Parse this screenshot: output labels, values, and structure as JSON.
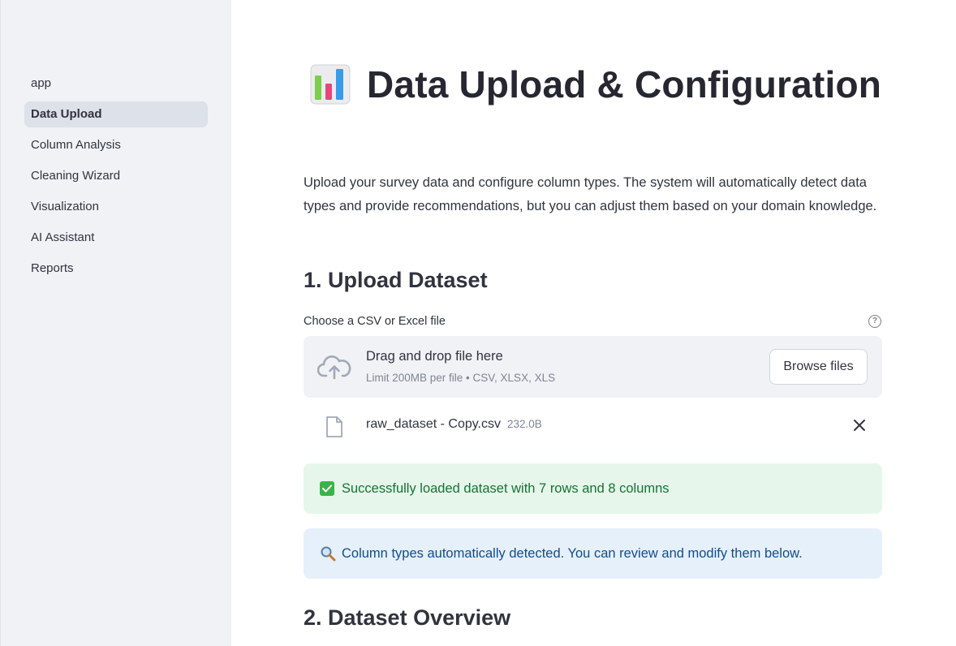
{
  "sidebar": {
    "items": [
      {
        "label": "app",
        "active": false
      },
      {
        "label": "Data Upload",
        "active": true
      },
      {
        "label": "Column Analysis",
        "active": false
      },
      {
        "label": "Cleaning Wizard",
        "active": false
      },
      {
        "label": "Visualization",
        "active": false
      },
      {
        "label": "AI Assistant",
        "active": false
      },
      {
        "label": "Reports",
        "active": false
      }
    ]
  },
  "page": {
    "title_icon": "bar-chart-icon",
    "title": "Data Upload & Configuration",
    "intro": "Upload your survey data and configure column types. The system will automatically detect data types and provide recommendations, but you can adjust them based on your domain knowledge."
  },
  "upload": {
    "heading": "1. Upload Dataset",
    "label": "Choose a CSV or Excel file",
    "help_icon": "?",
    "dropzone_main": "Drag and drop file here",
    "dropzone_sub": "Limit 200MB per file • CSV, XLSX, XLS",
    "browse_label": "Browse files",
    "file": {
      "name": "raw_dataset - Copy.csv",
      "size": "232.0B"
    }
  },
  "alerts": {
    "success": "Successfully loaded dataset with 7 rows and 8 columns",
    "info": "Column types automatically detected. You can review and modify them below."
  },
  "overview": {
    "heading": "2. Dataset Overview"
  },
  "colors": {
    "sidebar_bg": "#f0f2f6",
    "success_bg": "#e6f6eb",
    "info_bg": "#e6f0fb"
  }
}
